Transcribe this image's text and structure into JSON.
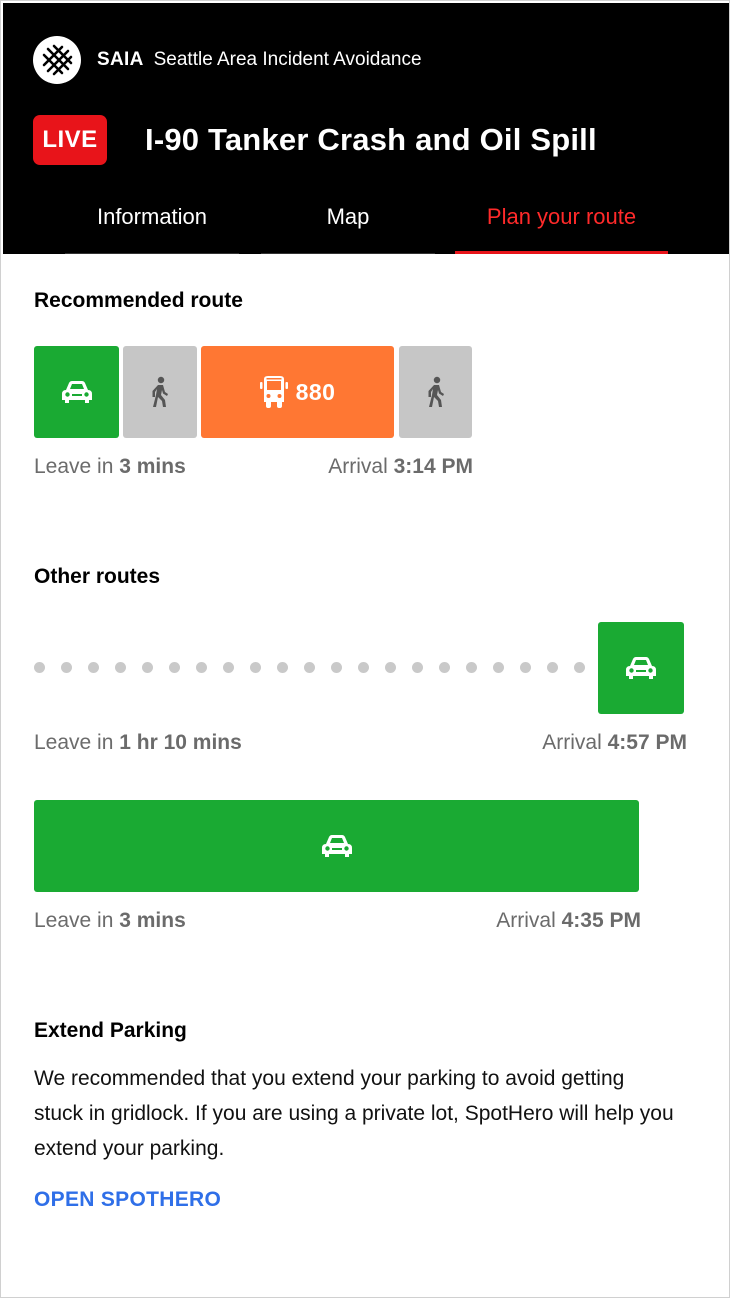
{
  "header": {
    "brand_short": "SAIA",
    "brand_long": "Seattle Area Incident Avoidance",
    "live_label": "LIVE",
    "title": "I-90 Tanker Crash and Oil Spill"
  },
  "tabs": [
    {
      "label": "Information",
      "active": false
    },
    {
      "label": "Map",
      "active": false
    },
    {
      "label": "Plan your route",
      "active": true
    }
  ],
  "recommended": {
    "heading": "Recommended route",
    "segments": [
      {
        "mode": "car-icon",
        "color": "#1aaa33"
      },
      {
        "mode": "walk-icon",
        "color": "#c6c6c6"
      },
      {
        "mode": "bus-icon",
        "color": "#ff7733",
        "label": "880"
      },
      {
        "mode": "walk-icon",
        "color": "#c6c6c6"
      }
    ],
    "leave_prefix": "Leave in",
    "leave_value": "3 mins",
    "arrival_prefix": "Arrival",
    "arrival_value": "3:14 PM"
  },
  "other": {
    "heading": "Other routes",
    "routes": [
      {
        "leave_prefix": "Leave in",
        "leave_value": "1 hr 10 mins",
        "arrival_prefix": "Arrival",
        "arrival_value": "4:57 PM"
      },
      {
        "leave_prefix": "Leave in",
        "leave_value": "3 mins",
        "arrival_prefix": "Arrival",
        "arrival_value": "4:35 PM"
      }
    ]
  },
  "parking": {
    "heading": "Extend Parking",
    "body": "We recommended that you extend your parking to avoid getting stuck in gridlock. If you are using a private lot, SpotHero will help you extend your parking.",
    "link": "OPEN SPOTHERO"
  },
  "colors": {
    "accent_red": "#e8141a",
    "car_green": "#1aaa33",
    "bus_orange": "#ff7733",
    "walk_grey": "#c6c6c6",
    "link_blue": "#2f6fe8"
  }
}
